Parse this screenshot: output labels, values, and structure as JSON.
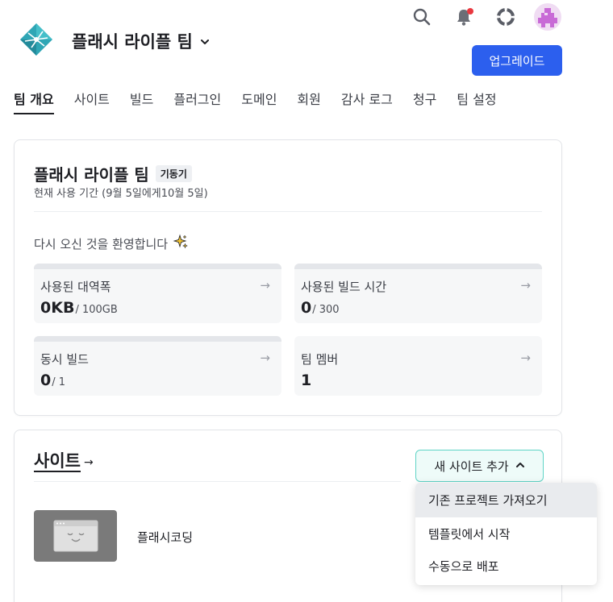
{
  "header": {
    "team_name": "플래시 라이플 팀",
    "upgrade_label": "업그레이드",
    "icons": {
      "logo": "netlify-logo",
      "search": "search-icon",
      "notifications": "bell-icon",
      "help": "lifebuoy-icon",
      "avatar": "avatar"
    },
    "colors": {
      "accent": "#2c5fee",
      "notification": "#e9383f"
    }
  },
  "nav": {
    "tabs": [
      {
        "label": "팀 개요",
        "active": true
      },
      {
        "label": "사이트",
        "active": false
      },
      {
        "label": "빌드",
        "active": false
      },
      {
        "label": "플러그인",
        "active": false
      },
      {
        "label": "도메인",
        "active": false
      },
      {
        "label": "회원",
        "active": false
      },
      {
        "label": "감사 로그",
        "active": false
      },
      {
        "label": "청구",
        "active": false
      },
      {
        "label": "팀 설정",
        "active": false
      }
    ]
  },
  "team_card": {
    "title": "플래시 라이플 팀",
    "plan_badge": "기동기",
    "period": "현재 사용 기간 (9월 5일에게10월 5일)",
    "welcome": "다시 오신 것을 환영합니다",
    "welcome_icon": "sparkles-icon",
    "stats": [
      {
        "label": "사용된 대역폭",
        "value": "0KB",
        "total": "/ 100GB",
        "arrow": "→"
      },
      {
        "label": "사용된 빌드 시간",
        "value": "0",
        "total": "/ 300",
        "arrow": "→"
      },
      {
        "label": "동시 빌드",
        "value": "0",
        "total": "/ 1",
        "arrow": "→"
      },
      {
        "label": "팀 멤버",
        "value": "1",
        "total": "",
        "arrow": "→"
      }
    ]
  },
  "sites_card": {
    "title": "사이트",
    "title_arrow": "→",
    "add_site_label": "새 사이트 추가",
    "sites": [
      {
        "name": "플래시코딩"
      }
    ],
    "dropdown": [
      {
        "label": "기존 프로젝트 가져오기"
      },
      {
        "label": "템플릿에서 시작"
      },
      {
        "label": "수동으로 배포"
      }
    ]
  }
}
